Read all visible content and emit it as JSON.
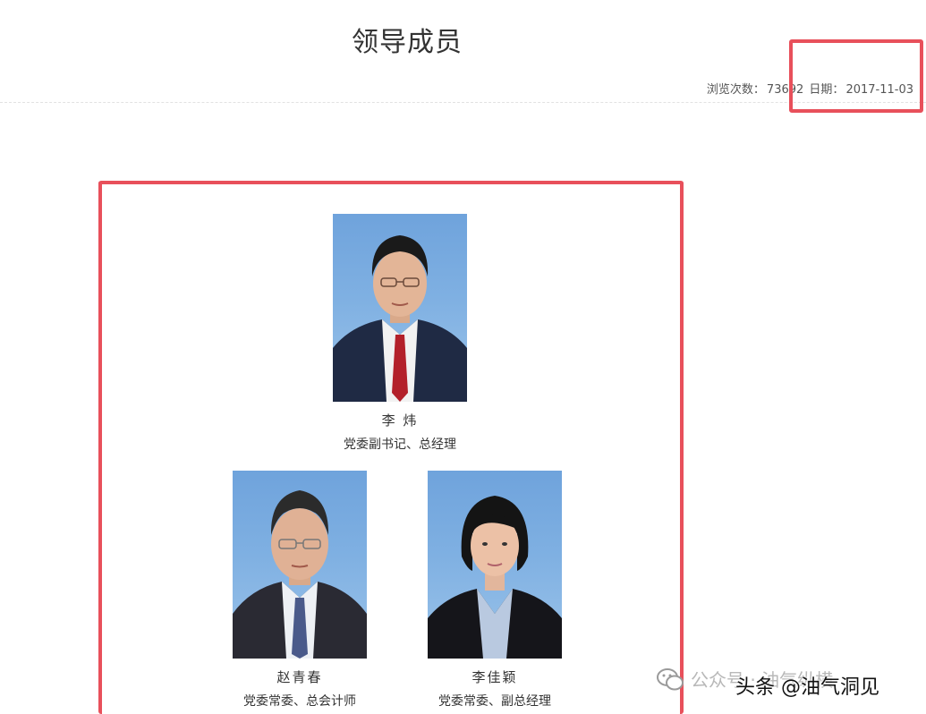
{
  "header": {
    "title": "领导成员",
    "views_label": "浏览次数：",
    "views_count": "73692",
    "date_label": "日期：",
    "date_value": "2017-11-03"
  },
  "leaders": [
    {
      "name": "李  炜",
      "title": "党委副书记、总经理",
      "photo": "portrait-man-red-tie"
    },
    {
      "name": "赵青春",
      "title": "党委常委、总会计师",
      "photo": "portrait-man-blue-tie"
    },
    {
      "name": "李佳颖",
      "title": "党委常委、副总经理",
      "photo": "portrait-woman"
    }
  ],
  "watermark": {
    "faded_text": "公众号 · 油气纵横",
    "main_text": "头条 @油气洞见",
    "icon": "wechat-icon"
  },
  "colors": {
    "highlight": "#e8505b",
    "photo_background": "#7fb0e2"
  }
}
